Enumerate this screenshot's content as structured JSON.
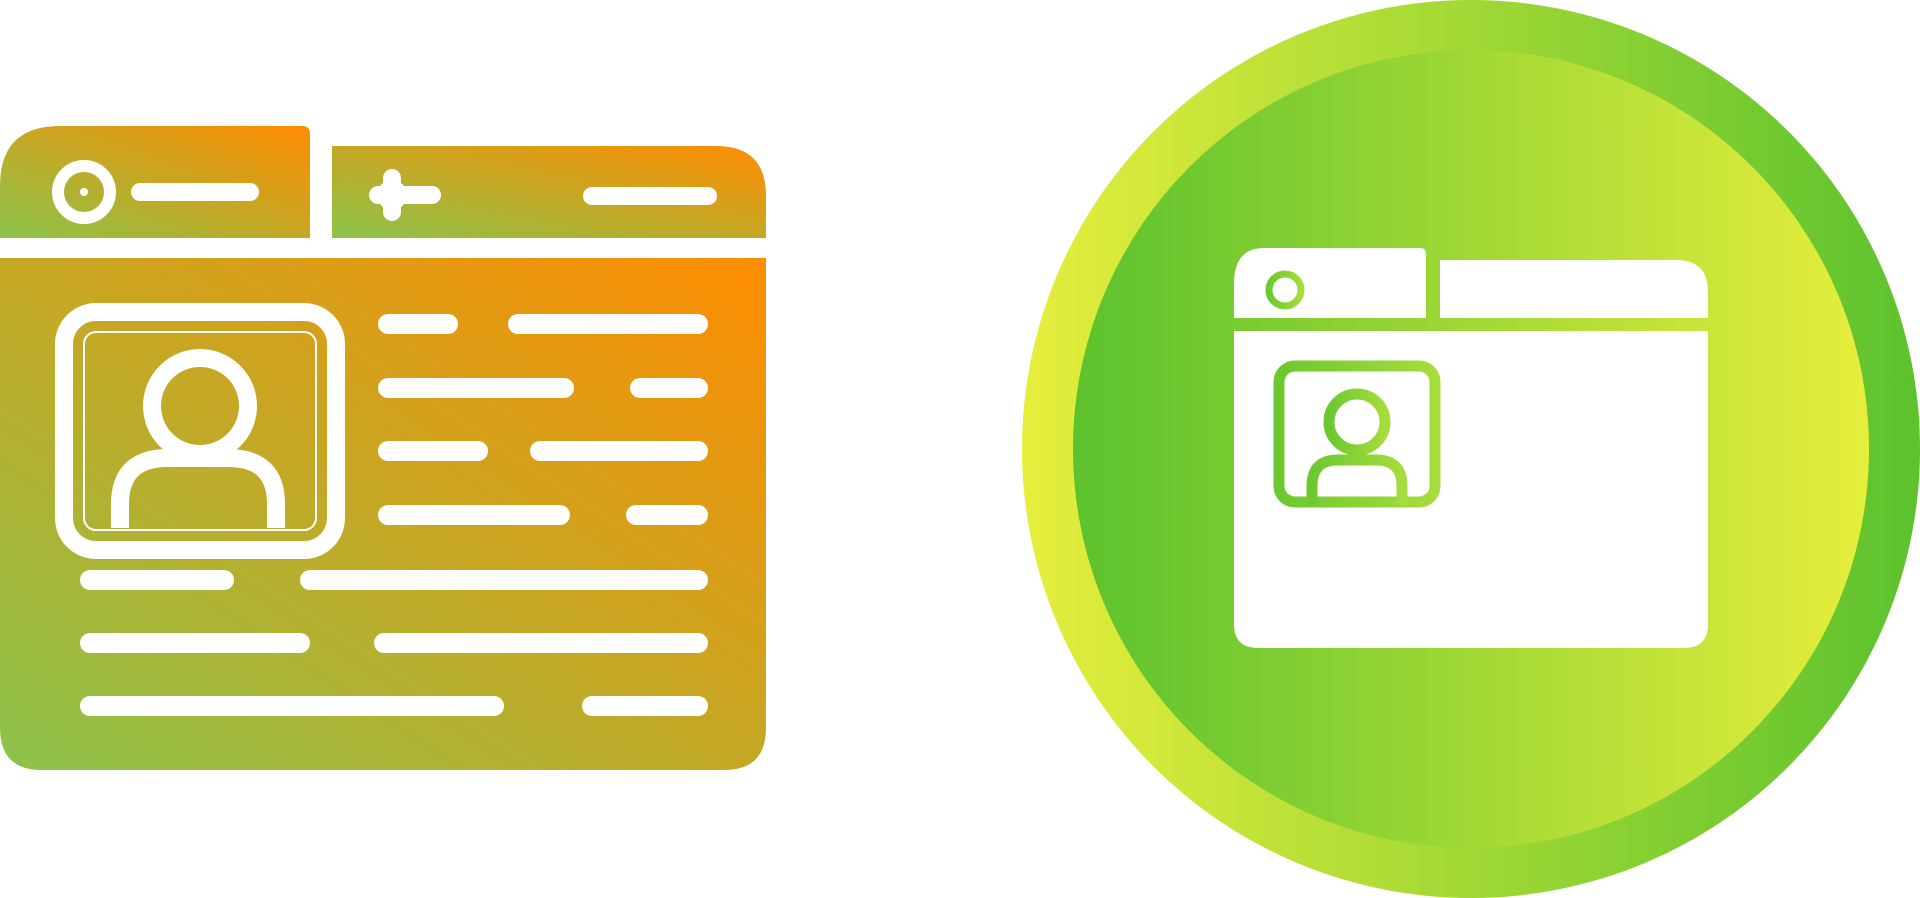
{
  "icons": [
    {
      "name": "profile-webpage-icon-gradient",
      "variant": "gradient-glyph",
      "colors": {
        "gradient_start": "#8bc34a",
        "gradient_end": "#ff8c00",
        "glyph": "#ffffff"
      }
    },
    {
      "name": "profile-webpage-icon-circle",
      "variant": "white-glyph-on-circle",
      "colors": {
        "outer_start": "#e6ee3c",
        "outer_end": "#5cc22e",
        "inner_start": "#5cc22e",
        "inner_end": "#e6ee3c",
        "glyph": "#ffffff",
        "glyph_lines": "#8fd63a"
      }
    }
  ]
}
